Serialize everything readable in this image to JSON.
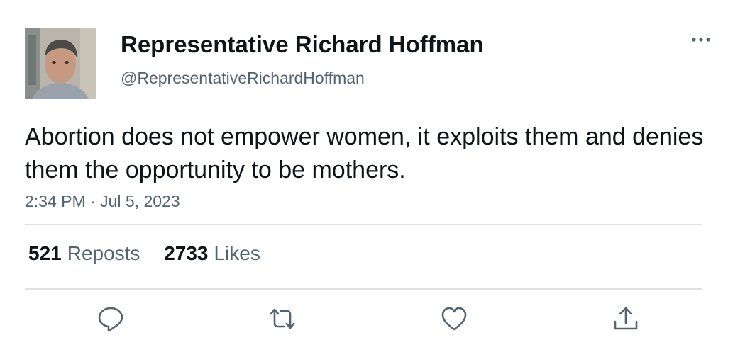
{
  "author": {
    "display_name": "Representative Richard Hoffman",
    "handle": "@RepresentativeRichardHoffman",
    "avatar_icon": "profile-photo"
  },
  "tweet": {
    "text": "Abortion does not empower women, it exploits them and denies them the opportunity to be mothers.",
    "timestamp": "2:34 PM · Jul 5, 2023"
  },
  "stats": {
    "reposts_count": "521",
    "reposts_label": "Reposts",
    "likes_count": "2733",
    "likes_label": "Likes"
  },
  "actions": {
    "reply_icon": "reply-icon",
    "repost_icon": "repost-icon",
    "like_icon": "heart-icon",
    "share_icon": "share-icon"
  },
  "colors": {
    "primary_text": "#0f1419",
    "secondary_text": "#536471",
    "divider": "#dde1e4",
    "icon": "#536471"
  }
}
